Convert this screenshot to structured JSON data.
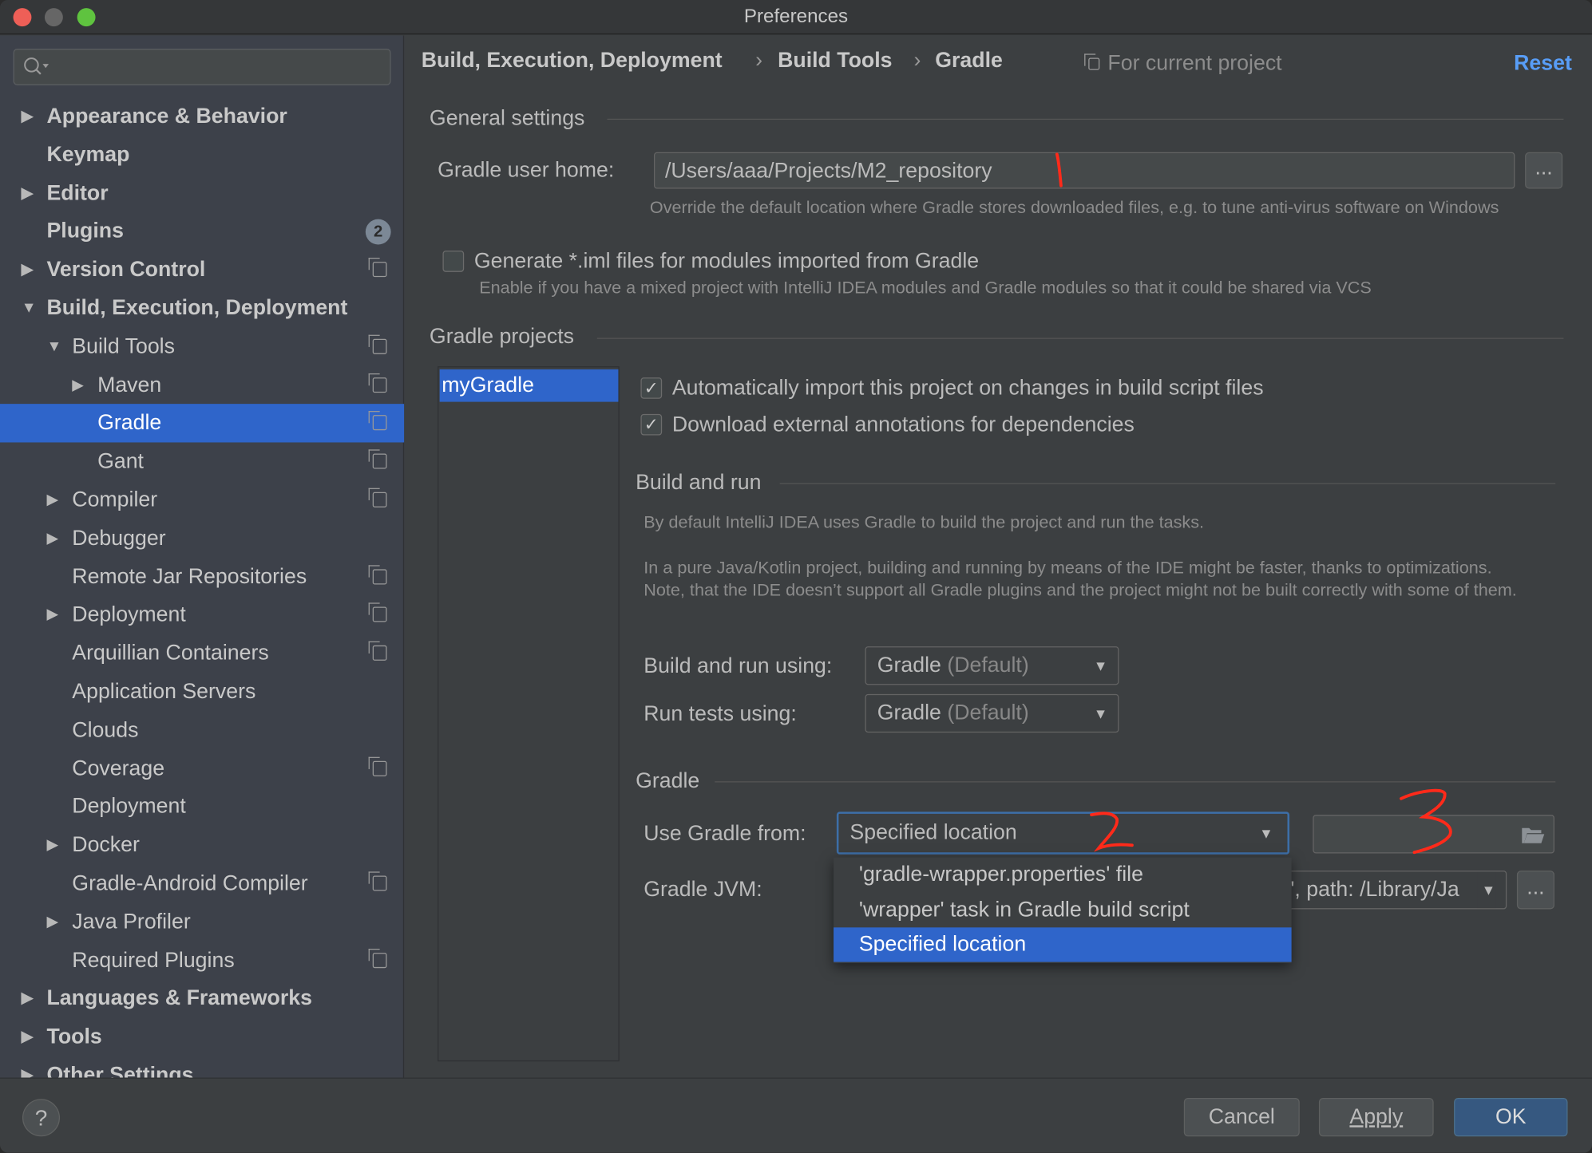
{
  "window": {
    "title": "Preferences"
  },
  "sidebar": {
    "search_placeholder": "",
    "items": [
      {
        "label": "Appearance & Behavior",
        "level": 0,
        "arrow": "right",
        "bold": true
      },
      {
        "label": "Keymap",
        "level": 0,
        "bold": true
      },
      {
        "label": "Editor",
        "level": 0,
        "arrow": "right",
        "bold": true
      },
      {
        "label": "Plugins",
        "level": 0,
        "bold": true,
        "badge": "2"
      },
      {
        "label": "Version Control",
        "level": 0,
        "arrow": "right",
        "bold": true,
        "project": true
      },
      {
        "label": "Build, Execution, Deployment",
        "level": 0,
        "arrow": "down",
        "bold": true
      },
      {
        "label": "Build Tools",
        "level": 1,
        "arrow": "down",
        "project": true
      },
      {
        "label": "Maven",
        "level": 2,
        "arrow": "right",
        "project": true
      },
      {
        "label": "Gradle",
        "level": 2,
        "selected": true,
        "project": true
      },
      {
        "label": "Gant",
        "level": 2,
        "project": true
      },
      {
        "label": "Compiler",
        "level": 1,
        "arrow": "right",
        "project": true
      },
      {
        "label": "Debugger",
        "level": 1,
        "arrow": "right"
      },
      {
        "label": "Remote Jar Repositories",
        "level": 1,
        "project": true
      },
      {
        "label": "Deployment",
        "level": 1,
        "arrow": "right",
        "project": true
      },
      {
        "label": "Arquillian Containers",
        "level": 1,
        "project": true
      },
      {
        "label": "Application Servers",
        "level": 1
      },
      {
        "label": "Clouds",
        "level": 1
      },
      {
        "label": "Coverage",
        "level": 1,
        "project": true
      },
      {
        "label": "Deployment",
        "level": 1
      },
      {
        "label": "Docker",
        "level": 1,
        "arrow": "right"
      },
      {
        "label": "Gradle-Android Compiler",
        "level": 1,
        "project": true
      },
      {
        "label": "Java Profiler",
        "level": 1,
        "arrow": "right"
      },
      {
        "label": "Required Plugins",
        "level": 1,
        "project": true
      },
      {
        "label": "Languages & Frameworks",
        "level": 0,
        "arrow": "right",
        "bold": true
      },
      {
        "label": "Tools",
        "level": 0,
        "arrow": "right",
        "bold": true
      },
      {
        "label": "Other Settings",
        "level": 0,
        "arrow": "right",
        "bold": true
      }
    ]
  },
  "header": {
    "breadcrumb": [
      "Build, Execution, Deployment",
      "Build Tools",
      "Gradle"
    ],
    "scope": "For current project",
    "reset": "Reset"
  },
  "general": {
    "title": "General settings",
    "user_home_label": "Gradle user home:",
    "user_home_value": "/Users/aaa/Projects/M2_repository",
    "browse": "...",
    "user_home_hint": "Override the default location where Gradle stores downloaded files, e.g. to tune anti-virus software on Windows",
    "iml_label": "Generate *.iml files for modules imported from Gradle",
    "iml_checked": false,
    "iml_hint": "Enable if you have a mixed project with IntelliJ IDEA modules and Gradle modules so that it could be shared via VCS"
  },
  "projects": {
    "title": "Gradle projects",
    "list": [
      "myGradle"
    ],
    "auto_import": "Automatically import this project on changes in build script files",
    "auto_import_checked": true,
    "annotations": "Download external annotations for dependencies",
    "annotations_checked": true
  },
  "build_run": {
    "title": "Build and run",
    "hint1": "By default IntelliJ IDEA uses Gradle to build the project and run the tasks.",
    "hint2": "In a pure Java/Kotlin project, building and running by means of the IDE might be faster, thanks to optimizations. Note, that the IDE doesn’t support all Gradle plugins and the project might not be built correctly with some of them.",
    "build_label": "Build and run using:",
    "build_value": "Gradle",
    "build_default": "(Default)",
    "tests_label": "Run tests using:",
    "tests_value": "Gradle",
    "tests_default": "(Default)"
  },
  "gradle": {
    "title": "Gradle",
    "use_from_label": "Use Gradle from:",
    "use_from_value": "Specified location",
    "location_value": "",
    "jvm_label": "Gradle JVM:",
    "jvm_value": "', path: /Library/Ja",
    "jvm_browse": "...",
    "options": [
      "'gradle-wrapper.properties' file",
      "'wrapper' task in Gradle build script",
      "Specified location"
    ],
    "selected_option": 2
  },
  "annotations": [
    "1",
    "2",
    "3"
  ],
  "footer": {
    "help": "?",
    "cancel": "Cancel",
    "apply": "Apply",
    "ok": "OK"
  },
  "colors": {
    "accent": "#2f65ca",
    "link": "#589df6",
    "annotation": "#ff2a1a"
  }
}
